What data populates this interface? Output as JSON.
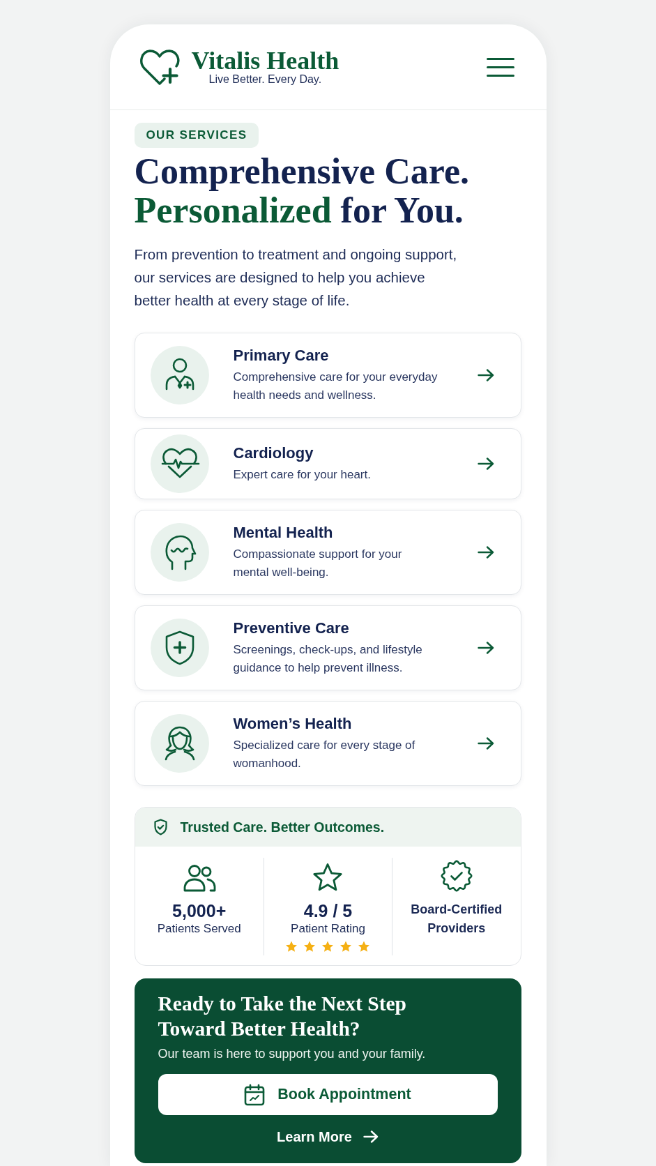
{
  "header": {
    "brand": "Vitalis Health",
    "tagline": "Live Better. Every Day."
  },
  "intro": {
    "eyebrow": "OUR SERVICES",
    "headline": {
      "line_1": "Comprehensive Care.",
      "line_2_highlight": "Personalized",
      "line_2_rest": "for You."
    },
    "description": "From prevention to treatment and ongoing support, our services are designed to help you achieve better health at every stage of life."
  },
  "services": [
    {
      "kind": "doctor",
      "title": "Primary Care",
      "description": "Comprehensive care for your everyday health needs and wellness."
    },
    {
      "kind": "heart",
      "title": "Cardiology",
      "description": "Expert care for your heart."
    },
    {
      "kind": "head",
      "title": "Mental Health",
      "description": "Compassionate support for your mental well-being."
    },
    {
      "kind": "shield",
      "title": "Preventive Care",
      "description": "Screenings, check-ups, and lifestyle guidance to help prevent illness."
    },
    {
      "kind": "woman",
      "title": "Women’s Health",
      "description": "Specialized care for every stage of womanhood."
    }
  ],
  "trust": {
    "title": "Trusted Care. Better Outcomes.",
    "stats": [
      {
        "kind": "people",
        "value": "5,000+",
        "label": "Patients Served"
      },
      {
        "kind": "rating",
        "value": "4.9 / 5",
        "label": "Patient Rating",
        "stars": 5
      },
      {
        "kind": "certified",
        "label": "Board-Certified Providers"
      }
    ]
  },
  "cta": {
    "title": "Ready to Take the Next Step Toward Better Health?",
    "subtitle": "Our team is here to support you and your family.",
    "primary_button": "Book Appointment",
    "secondary_link": "Learn More"
  }
}
